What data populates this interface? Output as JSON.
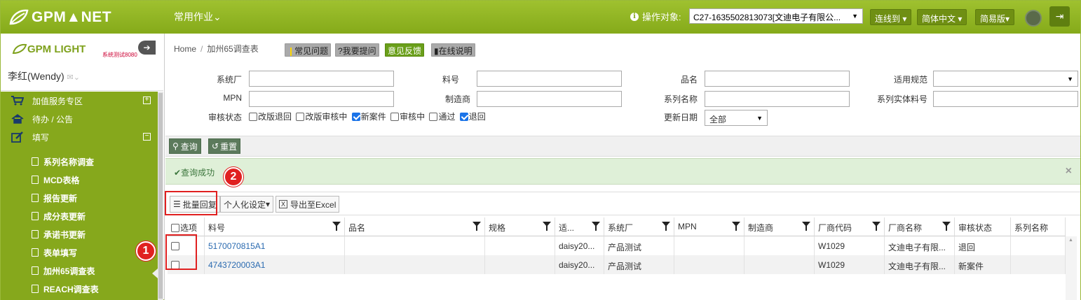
{
  "topbar": {
    "logo_text": "GPM▲NET",
    "menu_common": "常用作业",
    "op_label": "操作对象:",
    "op_value": "C27-1635502813073[文迪电子有限公...",
    "btn_connect": "连线到",
    "btn_lang": "简体中文",
    "btn_version": "简易版"
  },
  "sidebar": {
    "logo_text": "GPM LIGHT",
    "logo_sub": "系统测试8080",
    "user_name": "李红(Wendy)",
    "nav": [
      {
        "label": "加值服务专区",
        "toggle": "+"
      },
      {
        "label": "待办 / 公告"
      },
      {
        "label": "填写",
        "toggle": "−"
      }
    ],
    "sub_items": [
      "系列名称调查",
      "MCD表格",
      "报告更新",
      "成分表更新",
      "承诺书更新",
      "表单填写",
      "加州65调查表",
      "REACH调查表"
    ]
  },
  "breadcrumb": {
    "home": "Home",
    "sep": "/",
    "current": "加州65调查表"
  },
  "help": {
    "faq": "常见问题",
    "ask": "?我要提问",
    "feedback": "意见反馈",
    "online": "在线说明"
  },
  "filters": {
    "supplier": "系统厂",
    "part_no": "料号",
    "product_name": "品名",
    "spec": "适用规范",
    "mpn": "MPN",
    "manufacturer": "制造商",
    "series_name": "系列名称",
    "series_part": "系列实体料号",
    "review_status": "审核状态",
    "status_options": [
      {
        "label": "改版退回",
        "checked": false
      },
      {
        "label": "改版审核中",
        "checked": false
      },
      {
        "label": "新案件",
        "checked": true
      },
      {
        "label": "审核中",
        "checked": false
      },
      {
        "label": "通过",
        "checked": false
      },
      {
        "label": "退回",
        "checked": true
      }
    ],
    "update_date": "更新日期",
    "update_date_value": "全部"
  },
  "buttons": {
    "query": "查询",
    "reset": "重置"
  },
  "alert": {
    "text": "查询成功",
    "close": "×"
  },
  "toolbar": {
    "batch_reply": "批量回复",
    "personal": "个人化设定",
    "export": "导出至Excel"
  },
  "grid": {
    "headers": [
      "选项",
      "料号",
      "品名",
      "规格",
      "适...",
      "系统厂",
      "MPN",
      "制造商",
      "厂商代码",
      "厂商名称",
      "审核状态",
      "系列名称"
    ],
    "rows": [
      {
        "part": "5170070815A1",
        "name": "",
        "spec": "",
        "apply": "daisy20...",
        "supplier": "产品测试",
        "mpn": "",
        "mfr": "",
        "code": "W1029",
        "vendor": "文迪电子有限...",
        "status": "退回",
        "series": ""
      },
      {
        "part": "4743720003A1",
        "name": "",
        "spec": "",
        "apply": "daisy20...",
        "supplier": "产品测试",
        "mpn": "",
        "mfr": "",
        "code": "W1029",
        "vendor": "文迪电子有限...",
        "status": "新案件",
        "series": ""
      }
    ]
  },
  "annotations": {
    "one": "1",
    "two": "2"
  },
  "colors": {
    "brand_green": "#86a81c",
    "accent_red": "#e02020",
    "link": "#2a6ab0"
  }
}
